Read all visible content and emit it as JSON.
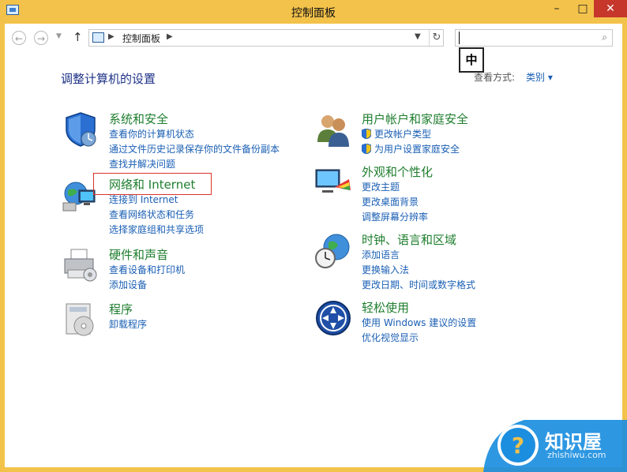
{
  "window": {
    "title": "控制面板",
    "controls": {
      "minimize": "–",
      "maximize": "□",
      "close": "✕"
    }
  },
  "nav": {
    "back_icon": "arrow-left-icon",
    "forward_icon": "arrow-right-icon",
    "up_icon": "arrow-up-icon",
    "address_crumb": "控制面板",
    "search_value": ""
  },
  "ime_indicator": "中",
  "header": {
    "title": "调整计算机的设置",
    "view_by_label": "查看方式:",
    "view_by_value": "类别 ▾"
  },
  "categories": [
    {
      "title": "系统和安全",
      "icon": "shield-icon",
      "links": [
        "查看你的计算机状态",
        "通过文件历史记录保存你的文件备份副本",
        "查找并解决问题"
      ]
    },
    {
      "title": "网络和 Internet",
      "icon": "network-globe-icon",
      "links": [
        "连接到 Internet",
        "查看网络状态和任务",
        "选择家庭组和共享选项"
      ]
    },
    {
      "title": "硬件和声音",
      "icon": "printer-icon",
      "links": [
        "查看设备和打印机",
        "添加设备"
      ]
    },
    {
      "title": "程序",
      "icon": "programs-disc-icon",
      "links": [
        "卸载程序"
      ]
    },
    {
      "title": "用户帐户和家庭安全",
      "icon": "users-icon",
      "links": [
        "更改帐户类型",
        "为用户设置家庭安全"
      ]
    },
    {
      "title": "外观和个性化",
      "icon": "display-palette-icon",
      "links": [
        "更改主题",
        "更改桌面背景",
        "调整屏幕分辨率"
      ]
    },
    {
      "title": "时钟、语言和区域",
      "icon": "clock-globe-icon",
      "links": [
        "添加语言",
        "更换输入法",
        "更改日期、时间或数字格式"
      ]
    },
    {
      "title": "轻松使用",
      "icon": "ease-of-access-icon",
      "links": [
        "使用 Windows 建议的设置",
        "优化视觉显示"
      ]
    }
  ],
  "watermark": {
    "text": "知识屋",
    "sub": "zhishiwu.com"
  },
  "colors": {
    "frame": "#f3c24a",
    "link": "#1a5fb4",
    "category": "#1e7e2e",
    "title": "#1e3287",
    "highlight": "#d9342b"
  }
}
